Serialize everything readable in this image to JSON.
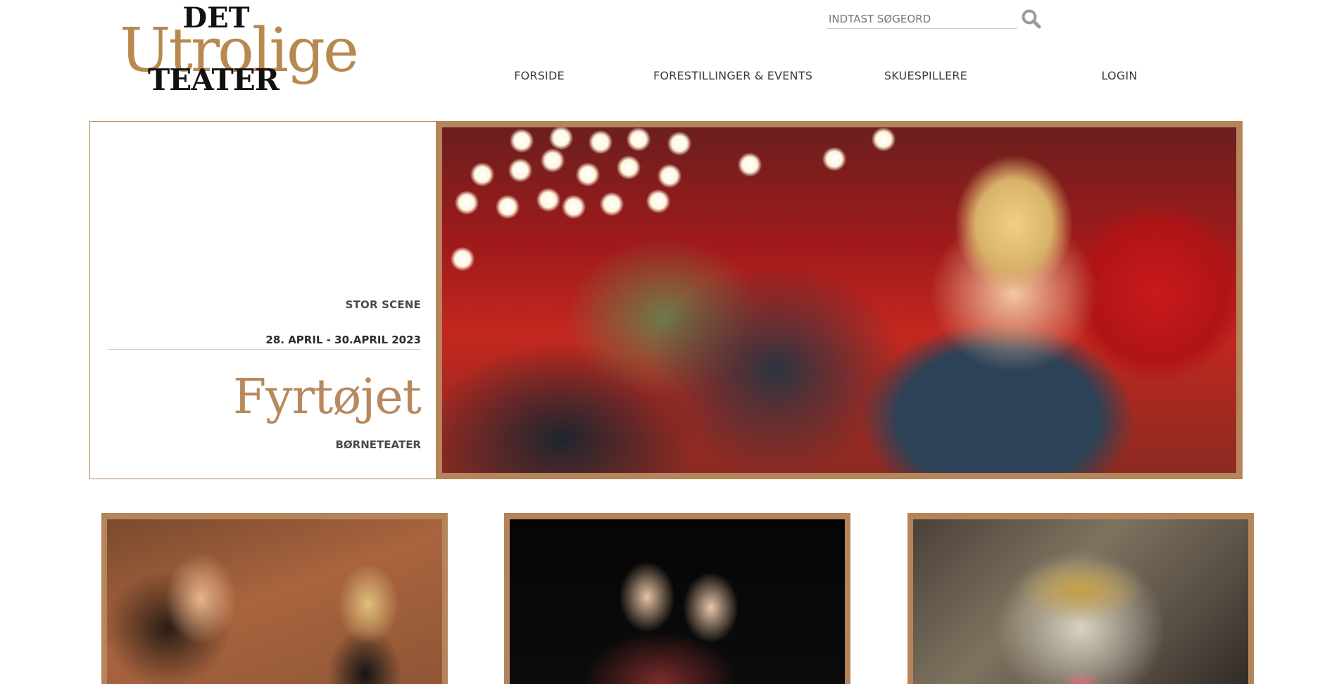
{
  "logo": {
    "top_word": "DET",
    "script_word": "Utrolige",
    "bottom_word": "TEATER"
  },
  "search": {
    "placeholder": "INDTAST SØGEORD",
    "icon": "search-icon"
  },
  "nav": {
    "items": [
      {
        "label": "FORSIDE"
      },
      {
        "label": "FORESTILLINGER & EVENTS"
      },
      {
        "label": "SKUESPILLERE"
      },
      {
        "label": "LOGIN"
      }
    ]
  },
  "hero": {
    "venue": "STOR SCENE",
    "dates": "28. APRIL - 30.APRIL 2023",
    "title": "Fyrtøjet",
    "genre": "BØRNETEATER"
  },
  "colors": {
    "accent": "#b8895d",
    "frame": "#b5845a",
    "text_dark": "#3b3b3b"
  }
}
